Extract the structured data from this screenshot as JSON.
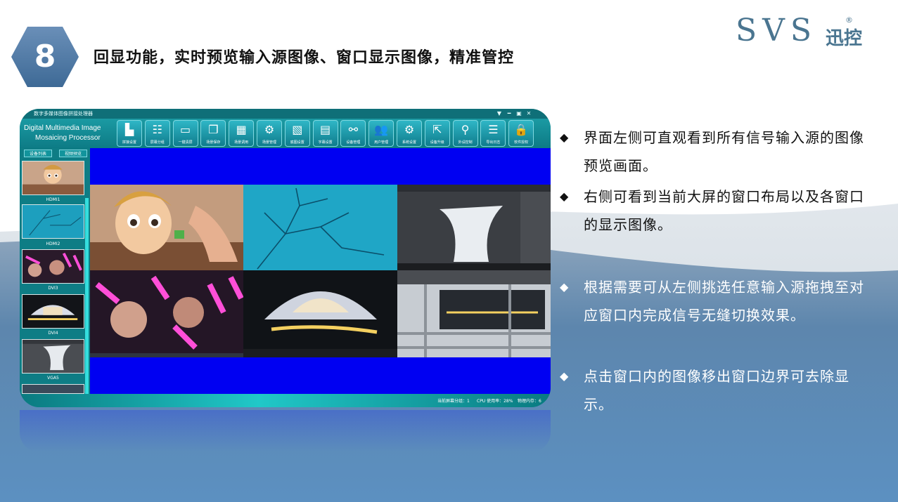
{
  "slide": {
    "number": "8",
    "title": "回显功能，实时预览输入源图像、窗口显示图像，精准管控"
  },
  "logo": {
    "latin": "SVS",
    "reg": "®",
    "chinese": "迅控"
  },
  "app": {
    "window_title": "数字多媒体图像拼接处理器",
    "brand_line1": "Digital Multimedia Image",
    "brand_line2": "Mosaicing Processor",
    "toolbar": [
      {
        "label": "拼接设置",
        "icon": "splice-settings-icon"
      },
      {
        "label": "屏幕分组",
        "icon": "screen-group-icon"
      },
      {
        "label": "一键清屏",
        "icon": "clear-screen-icon"
      },
      {
        "label": "场景保存",
        "icon": "scene-save-icon"
      },
      {
        "label": "场景调用",
        "icon": "scene-load-icon"
      },
      {
        "label": "场景管理",
        "icon": "scene-manage-icon"
      },
      {
        "label": "底图设置",
        "icon": "background-image-icon"
      },
      {
        "label": "字幕设置",
        "icon": "subtitle-icon"
      },
      {
        "label": "设备管理",
        "icon": "device-manage-icon"
      },
      {
        "label": "用户管理",
        "icon": "user-manage-icon"
      },
      {
        "label": "系统设置",
        "icon": "system-settings-icon"
      },
      {
        "label": "设备升级",
        "icon": "device-upgrade-icon"
      },
      {
        "label": "外设控制",
        "icon": "peripheral-control-icon"
      },
      {
        "label": "导出日志",
        "icon": "export-log-icon"
      },
      {
        "label": "软件授权",
        "icon": "license-lock-icon"
      }
    ],
    "sidebar_tabs": [
      "设备列表",
      "视频预览"
    ],
    "sources": [
      "HDMI1",
      "HDMI2",
      "DVI3",
      "DVI4",
      "VGA5"
    ],
    "status": {
      "screen_group": "当前屏幕分组：1",
      "cpu": "CPU 使用率：28%",
      "memory": "物理内存：6"
    },
    "colors": {
      "accent": "#0f7c8c",
      "canvas": "#0000f2"
    }
  },
  "bullets": [
    {
      "text": "界面左侧可直观看到所有信号输入源的图像预览画面。"
    },
    {
      "text": "右侧可看到当前大屏的窗口布局以及各窗口的显示图像。"
    },
    {
      "text": "根据需要可从左侧挑选任意输入源拖拽至对应窗口内完成信号无缝切换效果。"
    },
    {
      "text": "点击窗口内的图像移出窗口边界可去除显示。"
    }
  ],
  "bullet_marker": "◆"
}
